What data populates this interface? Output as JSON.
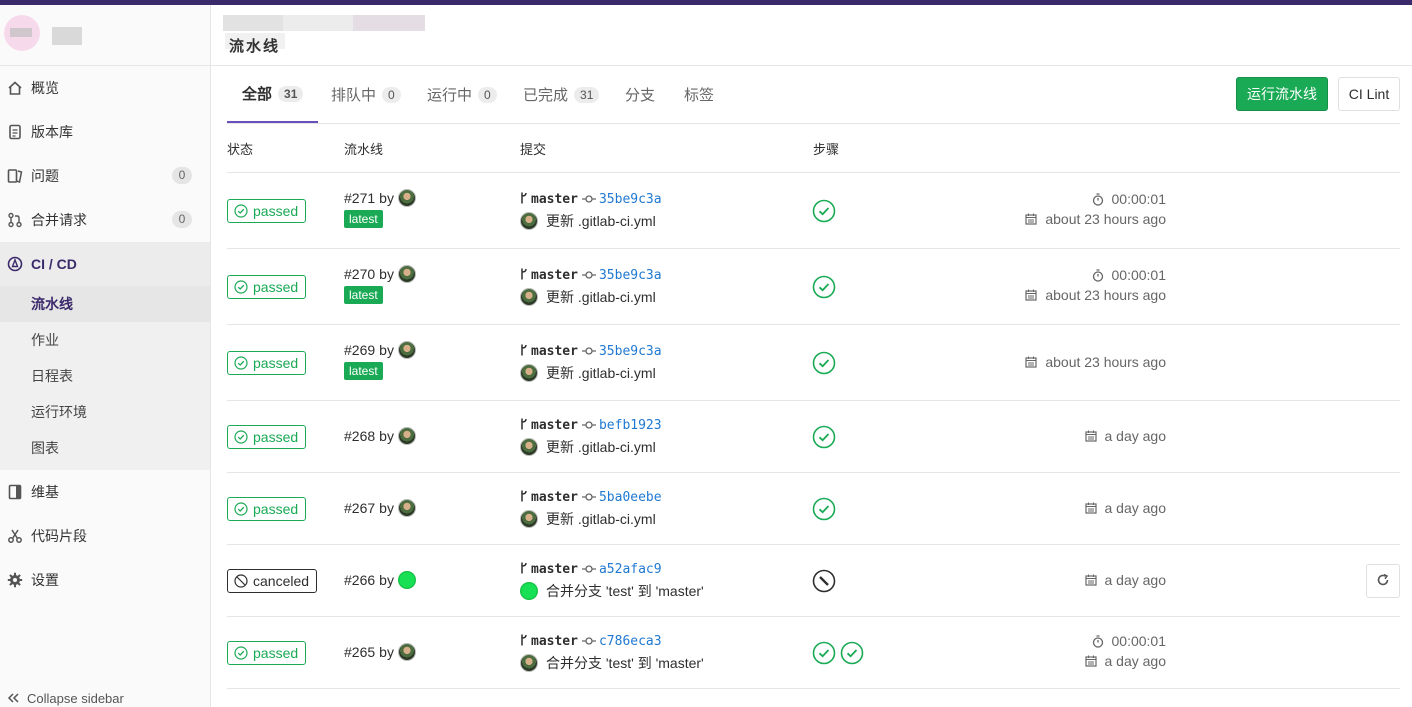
{
  "sidebar": {
    "items": [
      {
        "label": "概览",
        "icon": "home-icon"
      },
      {
        "label": "版本库",
        "icon": "document-icon"
      },
      {
        "label": "问题",
        "icon": "issues-icon",
        "count": "0"
      },
      {
        "label": "合并请求",
        "icon": "merge-request-icon",
        "count": "0"
      },
      {
        "label": "CI / CD",
        "icon": "rocket-icon",
        "active": true
      }
    ],
    "sub_items": [
      {
        "label": "流水线",
        "active": true
      },
      {
        "label": "作业"
      },
      {
        "label": "日程表"
      },
      {
        "label": "运行环境"
      },
      {
        "label": "图表"
      }
    ],
    "bottom_items": [
      {
        "label": "维基",
        "icon": "book-icon"
      },
      {
        "label": "代码片段",
        "icon": "scissors-icon"
      },
      {
        "label": "设置",
        "icon": "gear-icon"
      }
    ],
    "collapse_label": "Collapse sidebar"
  },
  "header": {
    "title": "流水线"
  },
  "tabs": [
    {
      "label": "全部",
      "count": "31",
      "active": true
    },
    {
      "label": "排队中",
      "count": "0"
    },
    {
      "label": "运行中",
      "count": "0"
    },
    {
      "label": "已完成",
      "count": "31"
    },
    {
      "label": "分支"
    },
    {
      "label": "标签"
    }
  ],
  "buttons": {
    "run_pipeline": "运行流水线",
    "ci_lint": "CI Lint"
  },
  "table": {
    "headers": {
      "status": "状态",
      "pipeline": "流水线",
      "commit": "提交",
      "stages": "步骤"
    },
    "rows": [
      {
        "status": "passed",
        "id": "#271",
        "by": "by",
        "latest": "latest",
        "branch": "master",
        "sha": "35be9c3a",
        "message": "更新 .gitlab-ci.yml",
        "stages": [
          "passed"
        ],
        "duration": "00:00:01",
        "finished": "about 23 hours ago"
      },
      {
        "status": "passed",
        "id": "#270",
        "by": "by",
        "latest": "latest",
        "branch": "master",
        "sha": "35be9c3a",
        "message": "更新 .gitlab-ci.yml",
        "stages": [
          "passed"
        ],
        "duration": "00:00:01",
        "finished": "about 23 hours ago"
      },
      {
        "status": "passed",
        "id": "#269",
        "by": "by",
        "latest": "latest",
        "branch": "master",
        "sha": "35be9c3a",
        "message": "更新 .gitlab-ci.yml",
        "stages": [
          "passed"
        ],
        "finished": "about 23 hours ago"
      },
      {
        "status": "passed",
        "id": "#268",
        "by": "by",
        "branch": "master",
        "sha": "befb1923",
        "message": "更新 .gitlab-ci.yml",
        "stages": [
          "passed"
        ],
        "finished": "a day ago"
      },
      {
        "status": "passed",
        "id": "#267",
        "by": "by",
        "branch": "master",
        "sha": "5ba0eebe",
        "message": "更新 .gitlab-ci.yml",
        "stages": [
          "passed"
        ],
        "finished": "a day ago"
      },
      {
        "status": "canceled",
        "id": "#266",
        "by": "by",
        "branch": "master",
        "sha": "a52afac9",
        "message": "合并分支 'test' 到 'master'",
        "stages": [
          "canceled"
        ],
        "finished": "a day ago",
        "retry": true
      },
      {
        "status": "passed",
        "id": "#265",
        "by": "by",
        "branch": "master",
        "sha": "c786eca3",
        "message": "合并分支 'test' 到 'master'",
        "stages": [
          "passed",
          "passed"
        ],
        "duration": "00:00:01",
        "finished": "a day ago"
      }
    ]
  },
  "colors": {
    "accent": "#3b2a6b",
    "success": "#1aaa55",
    "link": "#1f78d1",
    "tab_underline": "#6b4fbb"
  }
}
